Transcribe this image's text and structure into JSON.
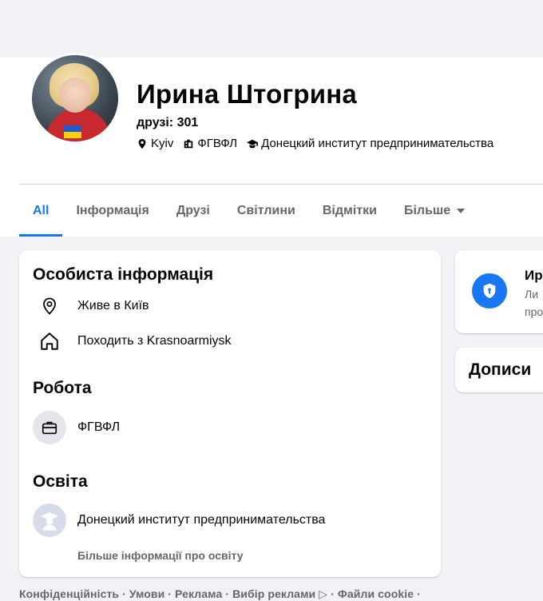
{
  "profile": {
    "name": "Ирина Штогрина",
    "friends": "друзі: 301",
    "city": "Kyiv",
    "work": "ФГВФЛ",
    "education": "Донецкий институт предпринимательства"
  },
  "tabs": [
    {
      "label": "All"
    },
    {
      "label": "Інформація"
    },
    {
      "label": "Друзі"
    },
    {
      "label": "Світлини"
    },
    {
      "label": "Відмітки"
    },
    {
      "label": "Більше"
    }
  ],
  "intro": {
    "personal_title": "Особиста інформація",
    "lives_in": "Живе в Київ",
    "from": "Походить з Krasnoarmiysk",
    "work_title": "Робота",
    "work_item": "ФГВФЛ",
    "education_title": "Освіта",
    "education_item": "Донецкий институт предпринимательства",
    "more_education": "Більше інформації про освіту"
  },
  "side": {
    "title": "Ир",
    "line1": "Ли",
    "line2": "про",
    "posts_title": "Дописи"
  },
  "footer": {
    "text": "Конфіденційність · Умови · Реклама · Вибір реклами ▷ · Файли cookie ·"
  },
  "colors": {
    "accent": "#1877f2",
    "background": "#f0f2f5",
    "secondary_text": "#65676b"
  }
}
